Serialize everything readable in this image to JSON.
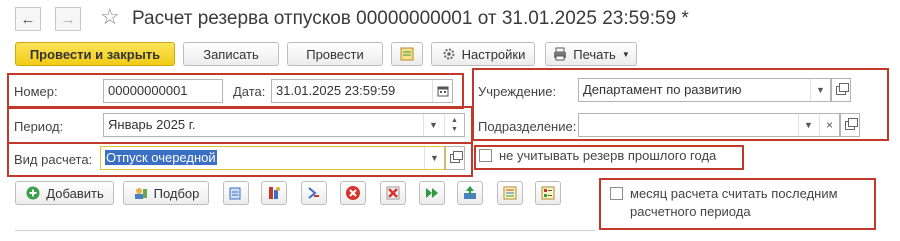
{
  "window": {
    "title": "Расчет резерва отпусков 00000000001 от 31.01.2025 23:59:59 *"
  },
  "toolbar": {
    "post_close_label": "Провести и закрыть",
    "save_label": "Записать",
    "post_label": "Провести",
    "settings_label": "Настройки",
    "print_label": "Печать"
  },
  "form": {
    "number_label": "Номер:",
    "number_value": "00000000001",
    "date_label": "Дата:",
    "date_value": "31.01.2025 23:59:59",
    "period_label": "Период:",
    "period_value": "Январь 2025 г.",
    "calc_type_label": "Вид расчета:",
    "calc_type_value": "Отпуск очередной",
    "institution_label": "Учреждение:",
    "institution_value": "Департамент по развитию",
    "subdivision_label": "Подразделение:",
    "subdivision_value": "",
    "ignore_prev_reserve_label": "не учитывать резерв прошлого года",
    "ignore_prev_reserve_checked": false,
    "last_month_label_line1": "месяц расчета считать последним",
    "last_month_label_line2": "расчетного периода",
    "last_month_checked": false
  },
  "table_toolbar": {
    "add_label": "Добавить",
    "pick_label": "Подбор"
  },
  "colors": {
    "accent_yellow": "#f2cb17",
    "highlight_red": "#c0392b",
    "selection_blue": "#3a6fc4"
  }
}
